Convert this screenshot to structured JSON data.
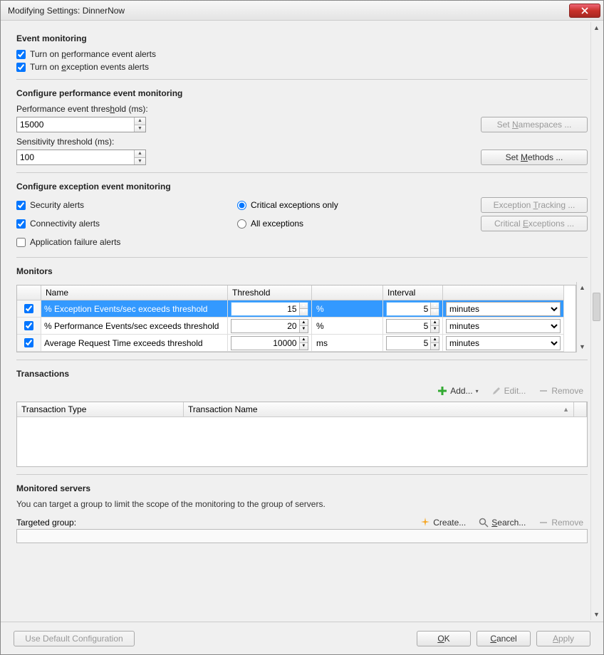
{
  "window": {
    "title": "Modifying Settings: DinnerNow"
  },
  "eventMonitoring": {
    "heading": "Event monitoring",
    "perfAlerts": {
      "label": "Turn on performance event alerts",
      "checked": true
    },
    "excAlerts": {
      "label": "Turn on exception events alerts",
      "checked": true
    }
  },
  "perfConfig": {
    "heading": "Configure performance event monitoring",
    "thresholdLabel": "Performance event threshold (ms):",
    "threshold": "15000",
    "sensitivityLabel": "Sensitivity threshold (ms):",
    "sensitivity": "100",
    "setNamespaces": "Set Namespaces ...",
    "setMethods": "Set Methods ..."
  },
  "excConfig": {
    "heading": "Configure exception event monitoring",
    "security": {
      "label": "Security alerts",
      "checked": true
    },
    "connectivity": {
      "label": "Connectivity alerts",
      "checked": true
    },
    "appFailure": {
      "label": "Application failure alerts",
      "checked": false
    },
    "criticalOnly": "Critical exceptions only",
    "allExceptions": "All exceptions",
    "radioSelected": "critical",
    "exceptionTracking": "Exception Tracking ...",
    "criticalExceptions": "Critical Exceptions ..."
  },
  "monitors": {
    "heading": "Monitors",
    "cols": {
      "name": "Name",
      "threshold": "Threshold",
      "interval": "Interval"
    },
    "rows": [
      {
        "checked": true,
        "name": "% Exception Events/sec exceeds threshold",
        "threshold": "15",
        "unit": "%",
        "interval": "5",
        "intervalUnit": "minutes",
        "selected": true
      },
      {
        "checked": true,
        "name": "% Performance Events/sec exceeds threshold",
        "threshold": "20",
        "unit": "%",
        "interval": "5",
        "intervalUnit": "minutes",
        "selected": false
      },
      {
        "checked": true,
        "name": "Average Request Time exceeds threshold",
        "threshold": "10000",
        "unit": "ms",
        "interval": "5",
        "intervalUnit": "minutes",
        "selected": false
      }
    ]
  },
  "transactions": {
    "heading": "Transactions",
    "add": "Add...",
    "edit": "Edit...",
    "remove": "Remove",
    "cols": {
      "type": "Transaction Type",
      "name": "Transaction Name"
    }
  },
  "servers": {
    "heading": "Monitored servers",
    "desc": "You can target a group to limit the scope of the monitoring to the group of servers.",
    "targetedLabel": "Targeted group:",
    "create": "Create...",
    "search": "Search...",
    "remove": "Remove"
  },
  "footer": {
    "useDefault": "Use Default Configuration",
    "ok": "OK",
    "cancel": "Cancel",
    "apply": "Apply"
  }
}
